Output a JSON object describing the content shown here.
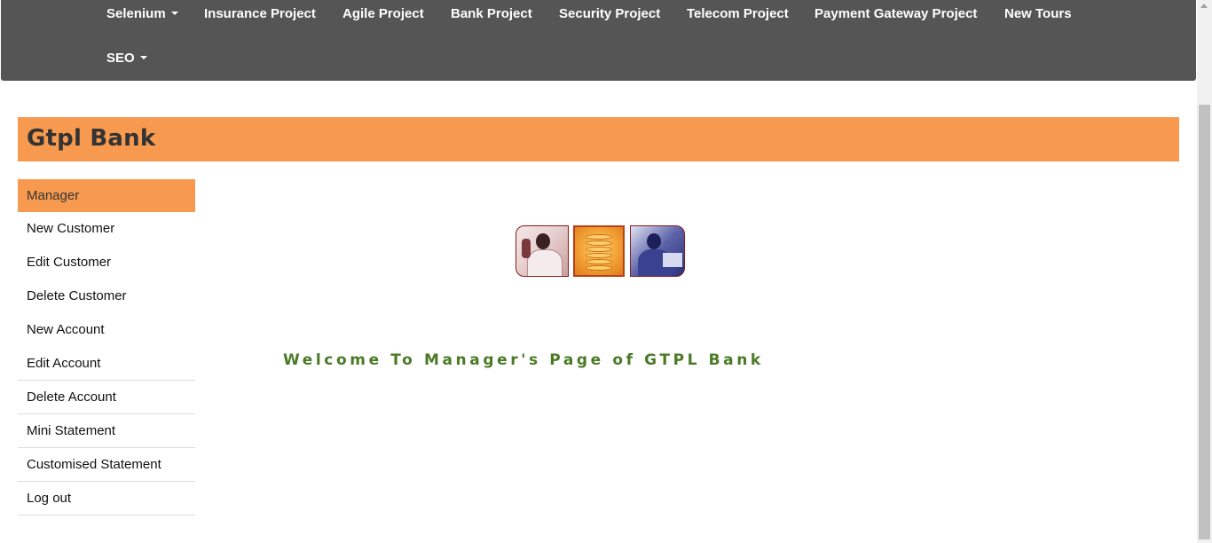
{
  "navbar": {
    "items": [
      {
        "label": "Selenium",
        "dropdown": true
      },
      {
        "label": "Insurance Project"
      },
      {
        "label": "Agile Project"
      },
      {
        "label": "Bank Project"
      },
      {
        "label": "Security Project"
      },
      {
        "label": "Telecom Project"
      },
      {
        "label": "Payment Gateway Project"
      },
      {
        "label": "New Tours"
      },
      {
        "label": "SEO",
        "dropdown": true
      }
    ]
  },
  "banner": {
    "title": "Gtpl Bank"
  },
  "menu": {
    "items": [
      {
        "label": "Manager",
        "active": true
      },
      {
        "label": "New Customer"
      },
      {
        "label": "Edit Customer"
      },
      {
        "label": "Delete Customer"
      },
      {
        "label": "New Account"
      },
      {
        "label": "Edit Account"
      },
      {
        "label": "Delete Account"
      },
      {
        "label": "Mini Statement"
      },
      {
        "label": "Customised Statement"
      },
      {
        "label": "Log out"
      }
    ]
  },
  "main": {
    "welcome": "Welcome To Manager's Page of GTPL Bank"
  },
  "colors": {
    "navbar_bg": "#555555",
    "accent": "#f79a50",
    "welcome_text": "#4a7a26"
  }
}
